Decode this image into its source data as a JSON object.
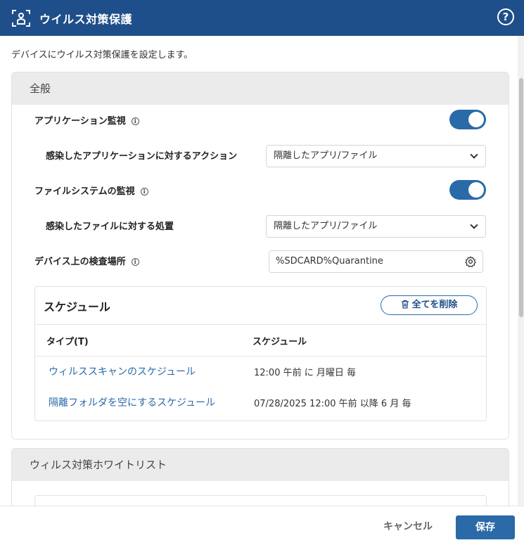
{
  "dialog": {
    "title": "ウイルス対策保護",
    "app_icon": "scan-shield-icon",
    "help_glyph": "?",
    "description": "デバイスにウイルス対策保護を設定します。"
  },
  "general": {
    "header": "全般",
    "app_monitoring": {
      "label": "アプリケーション監視",
      "enabled": true
    },
    "infected_app_action": {
      "label": "感染したアプリケーションに対するアクション",
      "value": "隔離したアプリ/ファイル"
    },
    "fs_monitoring": {
      "label": "ファイルシステムの監視",
      "enabled": true
    },
    "infected_file_action": {
      "label": "感染したファイルに対する処置",
      "value": "隔離したアプリ/ファイル"
    },
    "scan_location": {
      "label": "デバイス上の検査場所",
      "value": "%SDCARD%Quarantine"
    },
    "schedule": {
      "title": "スケジュール",
      "delete_all_label": "全てを削除",
      "columns": [
        "タイプ(T)",
        "スケジュール"
      ],
      "rows": [
        {
          "type": "ウィルススキャンのスケジュール",
          "schedule": "12:00 午前 に 月曜日 毎"
        },
        {
          "type": "隔離フォルダを空にするスケジュール",
          "schedule": "07/28/2025 12:00 午前 以降 6 月 毎"
        }
      ]
    }
  },
  "whitelist": {
    "header": "ウィルス対策ホワイトリスト"
  },
  "footer": {
    "cancel_label": "キャンセル",
    "save_label": "保存"
  },
  "colors": {
    "header_bg": "#1f4f8a",
    "accent": "#2a6aa8"
  },
  "info_glyph": "i"
}
